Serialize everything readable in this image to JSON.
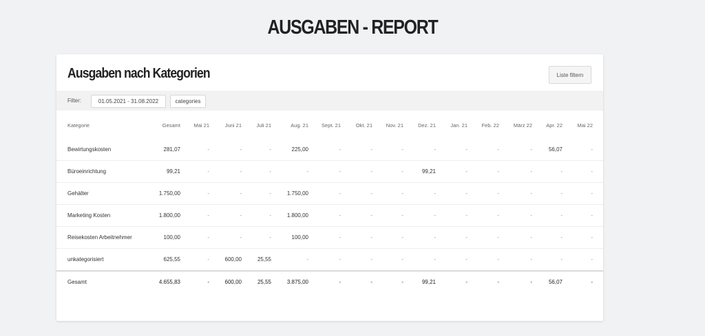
{
  "page": {
    "title": "AUSGABEN - REPORT"
  },
  "card": {
    "title": "Ausgaben nach Kategorien",
    "filter_button": "Liste filtern"
  },
  "filter": {
    "label": "Filter:",
    "date_range": "01.05.2021 - 31.08.2022",
    "categories": "categories"
  },
  "table": {
    "columns": [
      "Kategorie",
      "Gesamt",
      "Mai 21",
      "Juni 21",
      "Juli 21",
      "Aug. 21",
      "Sept. 21",
      "Okt. 21",
      "Nov. 21",
      "Dez. 21",
      "Jan. 21",
      "Feb. 22",
      "März 22",
      "Apr. 22",
      "Mai 22"
    ],
    "rows": [
      [
        "Bewirtungskosten",
        "281,07",
        "-",
        "-",
        "-",
        "225,00",
        "-",
        "-",
        "-",
        "-",
        "-",
        "-",
        "-",
        "56,07",
        "-"
      ],
      [
        "Büroeinrichtung",
        "99,21",
        "-",
        "-",
        "-",
        "-",
        "-",
        "-",
        "-",
        "99,21",
        "-",
        "-",
        "-",
        "-",
        "-"
      ],
      [
        "Gehälter",
        "1.750,00",
        "-",
        "-",
        "-",
        "1.750,00",
        "-",
        "-",
        "-",
        "-",
        "-",
        "-",
        "-",
        "-",
        "-"
      ],
      [
        "Marketing Kosten",
        "1.800,00",
        "-",
        "-",
        "-",
        "1.800,00",
        "-",
        "-",
        "-",
        "-",
        "-",
        "-",
        "-",
        "-",
        "-"
      ],
      [
        "Reisekosten Arbeitnehmer",
        "100,00",
        "-",
        "-",
        "-",
        "100,00",
        "-",
        "-",
        "-",
        "-",
        "-",
        "-",
        "-",
        "-",
        "-"
      ],
      [
        "unkategorisiert",
        "625,55",
        "-",
        "600,00",
        "25,55",
        "-",
        "-",
        "-",
        "-",
        "-",
        "-",
        "-",
        "-",
        "-",
        "-"
      ]
    ],
    "total": [
      "Gesamt",
      "4.655,83",
      "-",
      "600,00",
      "25,55",
      "3.875,00",
      "-",
      "-",
      "-",
      "99,21",
      "-",
      "-",
      "-",
      "56,07",
      "-"
    ]
  }
}
